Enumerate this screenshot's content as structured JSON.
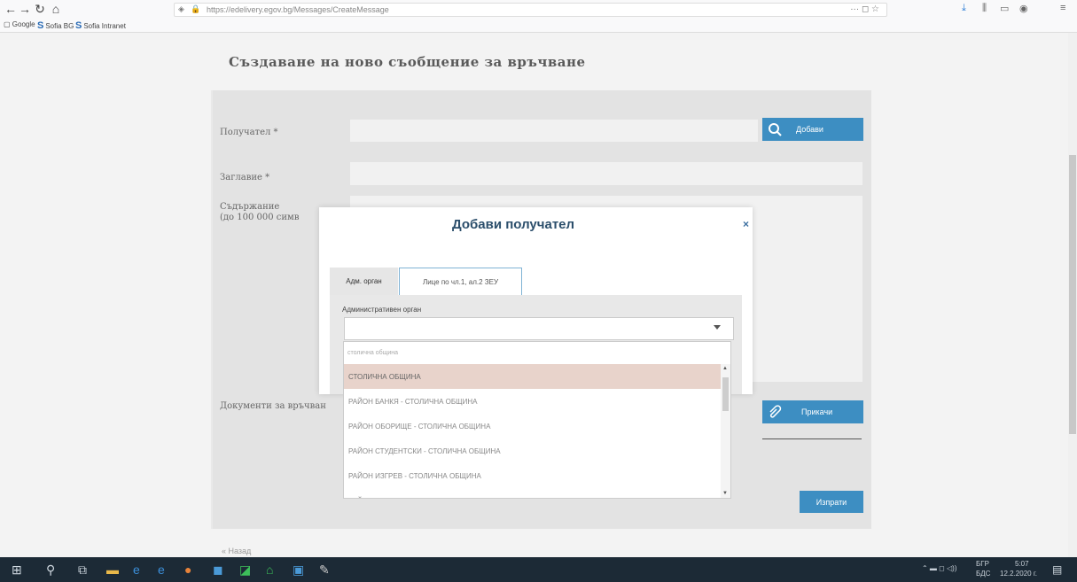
{
  "browser": {
    "url": "https://edelivery.egov.bg/Messages/CreateMessage",
    "bookmarks": [
      {
        "label": "Google"
      },
      {
        "label": "Sofia BG"
      },
      {
        "label": "Sofia Intranet"
      }
    ]
  },
  "page": {
    "title": "Създаване на ново съобщение за връчване",
    "fields": {
      "recipient_label": "Получател *",
      "subject_label": "Заглавие *",
      "content_label_line1": "Съдържание",
      "content_label_line2": "(до 100 000 симв",
      "documents_label": "Документи за връчван"
    },
    "buttons": {
      "add": "Добави",
      "attach": "Прикачи",
      "send": "Изпрати"
    },
    "back_link": "« Назад"
  },
  "modal": {
    "title": "Добави получател",
    "close": "×",
    "tabs": [
      "Адм. орган",
      "Лице по чл.1, ал.2 ЗЕУ"
    ],
    "select_label": "Административен орган",
    "select_value": ""
  },
  "dropdown": {
    "search_text": "столична община",
    "items": [
      "СТОЛИЧНА ОБЩИНА",
      "РАЙОН БАНКЯ - СТОЛИЧНА ОБЩИНА",
      "РАЙОН ОБОРИЩЕ - СТОЛИЧНА ОБЩИНА",
      "РАЙОН СТУДЕНТСКИ - СТОЛИЧНА ОБЩИНА",
      "РАЙОН ИЗГРЕВ - СТОЛИЧНА ОБЩИНА",
      "РАЙОН МЛАДОСТ - СТОЛИЧНА ОБЩИНА"
    ],
    "selected_index": 0
  },
  "taskbar": {
    "lang": "БГР",
    "lang2": "БДС",
    "time": "5:07",
    "date": "12.2.2020 г."
  },
  "colors": {
    "accent": "#3d8ec2",
    "modal_title": "#2b4e6b",
    "selected_item": "#e8d3cb"
  }
}
